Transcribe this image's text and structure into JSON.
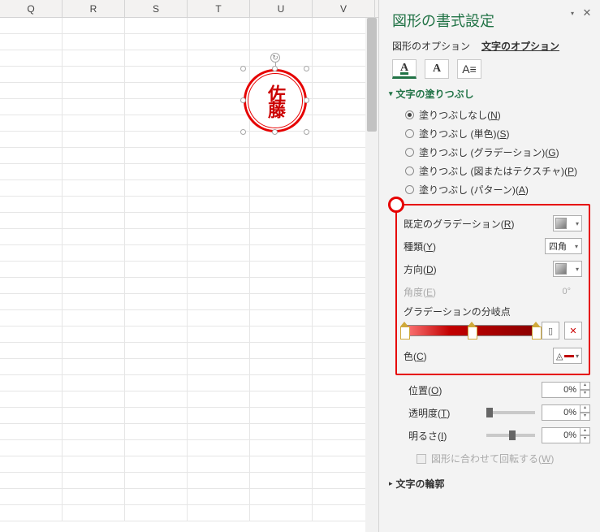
{
  "columns": [
    "Q",
    "R",
    "S",
    "T",
    "U",
    "V"
  ],
  "stamp_text": "佐藤",
  "panel": {
    "title": "図形の書式設定",
    "tabs": {
      "shape": "図形のオプション",
      "text": "文字のオプション"
    }
  },
  "section_fill": "文字の塗りつぶし",
  "radios": {
    "none": "塗りつぶしなし(N)",
    "solid": "塗りつぶし (単色)(S)",
    "gradient": "塗りつぶし (グラデーション)(G)",
    "picture": "塗りつぶし (図またはテクスチャ)(P)",
    "pattern": "塗りつぶし (パターン)(A)"
  },
  "fields": {
    "preset": "既定のグラデーション(R)",
    "type": "種類(Y)",
    "type_value": "四角",
    "direction": "方向(D)",
    "angle": "角度(E)",
    "angle_value": "0°",
    "stops": "グラデーションの分岐点",
    "color": "色(C)",
    "position": "位置(O)",
    "position_value": "0%",
    "transparency": "透明度(T)",
    "transparency_value": "0%",
    "brightness": "明るさ(I)",
    "brightness_value": "0%",
    "rotate_with_shape": "図形に合わせて回転する(W)"
  },
  "section_outline": "文字の輪郭",
  "icons": {
    "rot": "↻",
    "dd": "▾",
    "tri_down": "▾",
    "tri_right": "▸",
    "add": "▯",
    "del": "✕",
    "up": "▴",
    "dn": "▾"
  }
}
